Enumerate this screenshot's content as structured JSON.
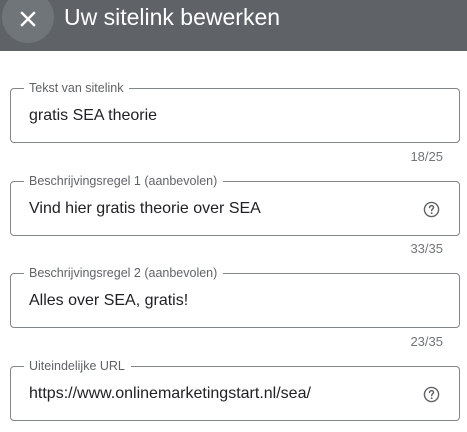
{
  "dialog": {
    "title": "Uw sitelink bewerken",
    "close_icon": "close-icon"
  },
  "fields": [
    {
      "label": "Tekst van sitelink",
      "value": "gratis SEA theorie",
      "counter": "18/25"
    },
    {
      "label": "Beschrijvingsregel 1 (aanbevolen)",
      "value": "Vind hier gratis theorie over SEA",
      "counter": "33/35",
      "icon": "help-icon"
    },
    {
      "label": "Beschrijvingsregel 2 (aanbevolen)",
      "value": "Alles over SEA, gratis!",
      "counter": "23/35"
    },
    {
      "label": "Uiteindelijke URL",
      "value": "https://www.onlinemarketingstart.nl/sea/",
      "icon": "help-icon"
    }
  ],
  "colors": {
    "header_bg": "#5f6368",
    "border": "#80868b",
    "label": "#5f6368",
    "counter": "#70757a"
  }
}
